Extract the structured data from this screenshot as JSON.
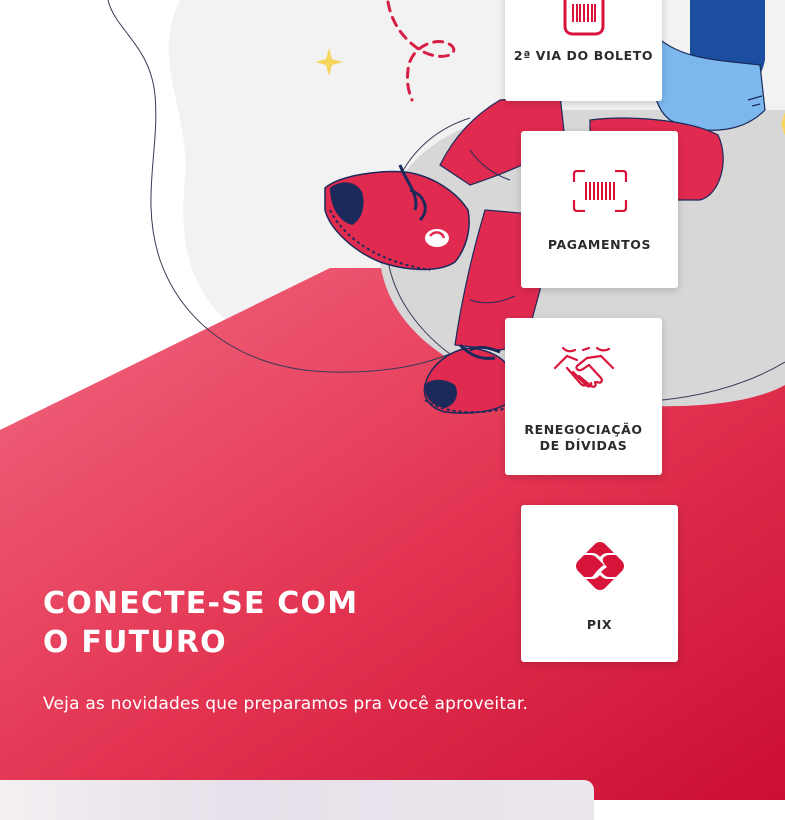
{
  "cards": {
    "boleto": {
      "label": "2ª VIA DO BOLETO",
      "icon": "boleto-barcode-icon"
    },
    "pagamentos": {
      "label": "PAGAMENTOS",
      "icon": "barcode-scan-icon"
    },
    "renegociacao": {
      "label": "RENEGOCIAÇÃO DE DÍVIDAS",
      "icon": "handshake-icon"
    },
    "pix": {
      "label": "PIX",
      "icon": "pix-icon"
    }
  },
  "hero": {
    "title_line1": "CONECTE-SE COM",
    "title_line2": "O FUTURO",
    "subtitle": "Veja as novidades que preparamos pra você aproveitar."
  },
  "colors": {
    "brand_red": "#d8143a",
    "gradient_start": "#f0607a",
    "gradient_end": "#cc0f35",
    "denim": "#1b4e9e",
    "denim_light": "#7cb8ee",
    "pants": "#e12a50",
    "blob_grey": "#d6d6d6",
    "sparkle": "#f6d45e",
    "label_text": "#2b2b2b"
  }
}
